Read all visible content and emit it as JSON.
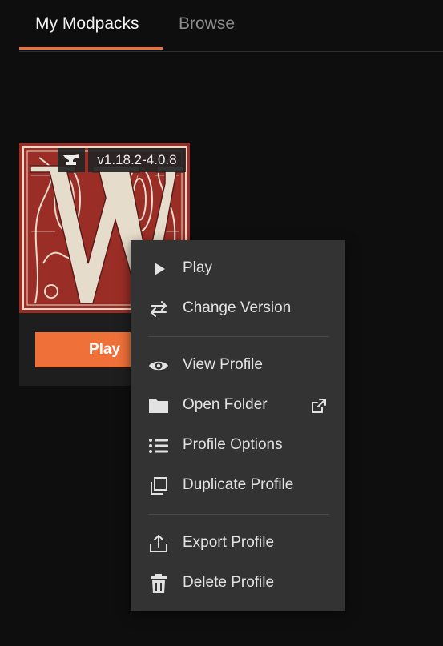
{
  "tabs": {
    "my_modpacks": "My Modpacks",
    "browse": "Browse"
  },
  "card": {
    "loader_icon": "anvil-icon",
    "version": "v1.18.2-4.0.8",
    "play_label": "Play"
  },
  "menu": {
    "play": "Play",
    "change_version": "Change Version",
    "view_profile": "View Profile",
    "open_folder": "Open Folder",
    "profile_options": "Profile Options",
    "duplicate_profile": "Duplicate Profile",
    "export_profile": "Export Profile",
    "delete_profile": "Delete Profile"
  },
  "colors": {
    "accent": "#f0703a",
    "background": "#0e0e0e",
    "menu_bg": "#333333",
    "art_red": "#9a2d26",
    "art_cream": "#e6dccb"
  }
}
